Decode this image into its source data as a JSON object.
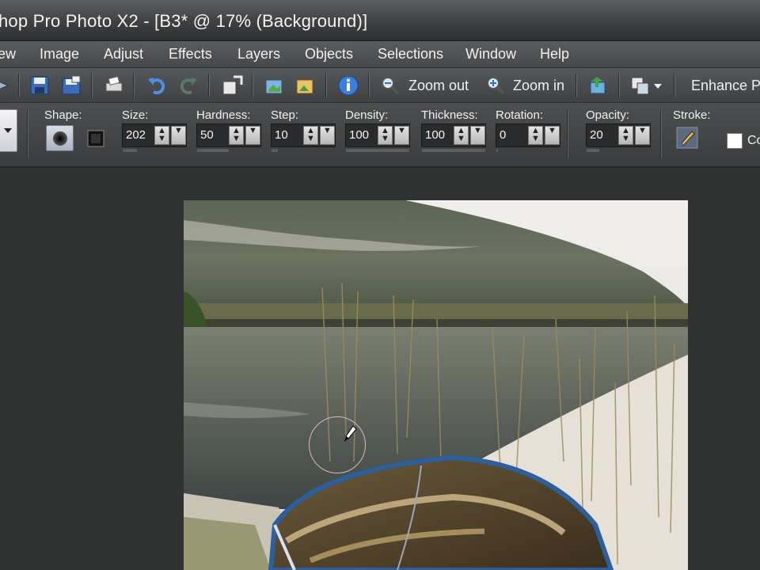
{
  "window": {
    "title": "hop Pro Photo X2 - [B3* @  17% (Background)]"
  },
  "menu": {
    "items": [
      "ew",
      "Image",
      "Adjust",
      "Effects",
      "Layers",
      "Objects",
      "Selections",
      "Window",
      "Help"
    ]
  },
  "toolbar": {
    "zoom_out_label": "Zoom out",
    "zoom_in_label": "Zoom in",
    "enhance_label": "Enhance Pl"
  },
  "options": {
    "shape_label": "Shape:",
    "size": {
      "label": "Size:",
      "value": "202"
    },
    "hardness": {
      "label": "Hardness:",
      "value": "50"
    },
    "step": {
      "label": "Step:",
      "value": "10"
    },
    "density": {
      "label": "Density:",
      "value": "100"
    },
    "thickness": {
      "label": "Thickness:",
      "value": "100"
    },
    "rotation": {
      "label": "Rotation:",
      "value": "0"
    },
    "opacity": {
      "label": "Opacity:",
      "value": "20"
    },
    "stroke_label": "Stroke:",
    "checkbox_label": "Co"
  },
  "colors": {
    "workspace": "#2f3231",
    "toolbar": "#46484a",
    "accent_blue": "#2a6fd6"
  }
}
